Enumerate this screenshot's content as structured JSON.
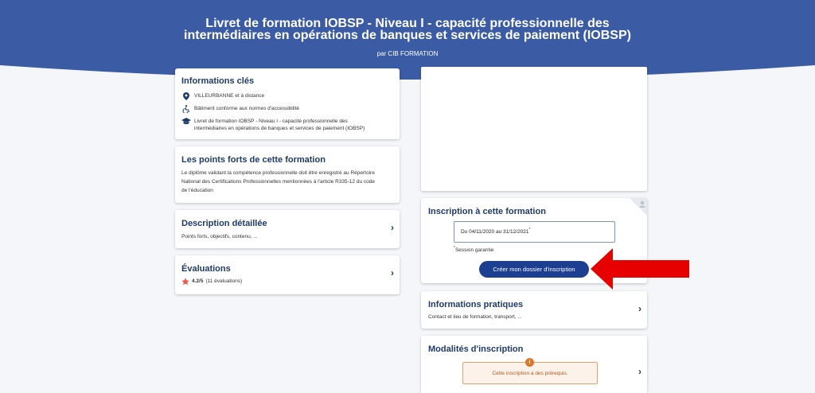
{
  "header": {
    "title_line1": "Livret de formation IOBSP - Niveau I - capacité professionnelle des",
    "title_line2": "intermédiaires en opérations de banques et services de paiement (IOBSP)",
    "byline": "par CIB FORMATION"
  },
  "info_cles": {
    "title": "Informations clés",
    "location": "VILLEURBANNE et à distance",
    "accessibility": "Bâtiment conforme aux normes d'accessibilité",
    "diploma_line1": "Livret de formation IOBSP - Niveau I - capacité professionnelle des",
    "diploma_line2": "intermédiaires en opérations de banques et services de paiement (IOBSP)"
  },
  "points_forts": {
    "title": "Les points forts de cette formation",
    "line1": "Le diplôme validant la compétence professionnelle doit être enregistré au Répertoire",
    "line2": "National des Certifications Professionnelles mentionnées à l'article R335-12 du code",
    "line3": "de l'éducation"
  },
  "description": {
    "title": "Description détaillée",
    "subtitle": "Points forts, objectifs, contenu, ..."
  },
  "evaluations": {
    "title": "Évaluations",
    "rating": "4.2/5",
    "count": "(11 évaluations)"
  },
  "inscription": {
    "title": "Inscription à cette formation",
    "session_dates": "Du 04/11/2020 au 31/12/2021",
    "asterisk": "*",
    "session_note": "Session garantie",
    "cta_label": "Créer mon dossier d'inscription"
  },
  "infos_pratiques": {
    "title": "Informations pratiques",
    "subtitle": "Contact et lieu de formation, transport, ..."
  },
  "modalites": {
    "title": "Modalités d'inscription",
    "warning_icon": "i",
    "warning": "Cette inscription a des prérequis."
  },
  "chevron": "›",
  "colors": {
    "banner": "#3b5ba5",
    "title_text": "#1f3a68",
    "cta": "#1d3f91",
    "star": "#e8574f",
    "warning_border": "#e9a06a",
    "warning_text": "#b4571d",
    "annotation_arrow": "#e60000"
  }
}
